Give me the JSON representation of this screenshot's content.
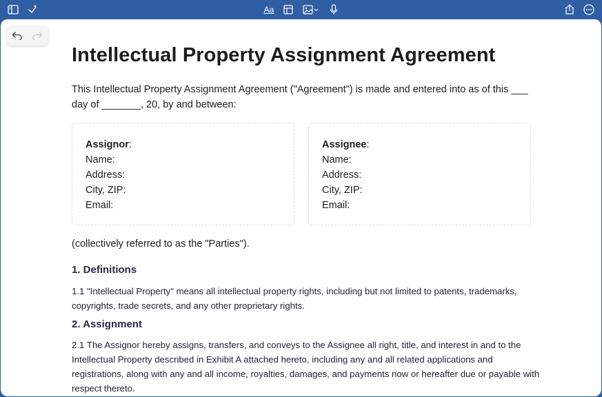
{
  "toolbar": {
    "left_icons": [
      "sidebar-icon",
      "magic-wand-icon"
    ],
    "center_icons": [
      "text-format-icon",
      "table-icon",
      "media-icon",
      "microphone-icon"
    ],
    "format_label": "Aa",
    "right_icons": [
      "share-icon",
      "more-icon"
    ]
  },
  "document": {
    "title": "Intellectual Property Assignment Agreement",
    "intro": "This Intellectual Property Assignment Agreement (\"Agreement\") is made and entered into as of this ___ day of _______, 20, by and between:",
    "parties": [
      {
        "heading": "Assignor",
        "fields": [
          "Name:",
          "Address:",
          "City, ZIP:",
          "Email:"
        ]
      },
      {
        "heading": "Assignee",
        "fields": [
          "Name:",
          "Address:",
          "City, ZIP:",
          "Email:"
        ]
      }
    ],
    "collective": "(collectively referred to as the \"Parties\").",
    "sections": [
      {
        "title": "1. Definitions",
        "body": "1.1 \"Intellectual Property\" means all intellectual property rights, including but not limited to patents, trademarks, copyrights, trade secrets, and any other proprietary rights."
      },
      {
        "title": "2. Assignment",
        "body": "2.1 The Assignor hereby assigns, transfers, and conveys to the Assignee all right, title, and interest in and to the Intellectual Property described in Exhibit A attached hereto, including any and all related applications and registrations, along with any and all income, royalties, damages, and payments now or hereafter due or payable with respect thereto."
      }
    ]
  },
  "colors": {
    "toolbar_bg": "#2f5ea3",
    "page_bg": "#ffffff",
    "text": "#1d1d1f"
  }
}
